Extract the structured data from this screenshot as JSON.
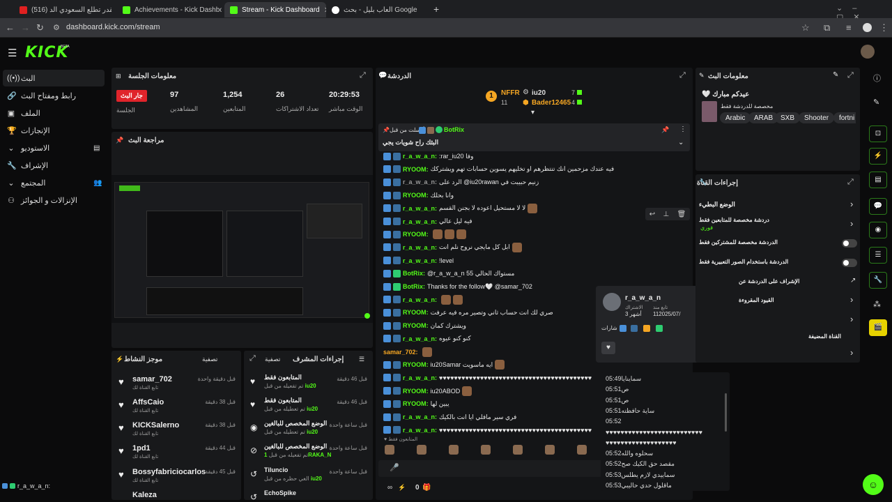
{
  "browser": {
    "tabs": [
      {
        "title": "(516) هل تقدر تطلع السعودي الد..."
      },
      {
        "title": "Achievements - Kick Dashboard"
      },
      {
        "title": "Stream - Kick Dashboard"
      },
      {
        "title": "العاب بليل - بحث Google"
      }
    ],
    "url": "dashboard.kick.com/stream",
    "new_tab": "+"
  },
  "app": {
    "logo": "KICK",
    "beta": "BETA"
  },
  "sidebar": {
    "items": [
      {
        "label": "البث",
        "icon": "live-icon"
      },
      {
        "label": "رابط ومفتاح البث",
        "icon": "link-icon"
      },
      {
        "label": "الملف",
        "icon": "profile-icon"
      },
      {
        "label": "الإنجازات",
        "icon": "trophy-icon"
      },
      {
        "label": "الاستوديو",
        "icon": "studio-icon"
      },
      {
        "label": "الإشراف",
        "icon": "wrench-icon"
      },
      {
        "label": "المجتمع",
        "icon": "community-icon"
      },
      {
        "label": "الإنزالات و الجوائز",
        "icon": "gift-icon"
      }
    ]
  },
  "session": {
    "title": "معلومات الجلسة",
    "live_badge": "جار البث",
    "stats": [
      {
        "label": "الجلسة",
        "value": ""
      },
      {
        "label": "المشاهدين",
        "value": "97"
      },
      {
        "label": "المتابعين",
        "value": "1,254"
      },
      {
        "label": "تعداد الاشتراكات",
        "value": "26"
      },
      {
        "label": "الوقت مباشر",
        "value": "20:29:53"
      }
    ]
  },
  "preview": {
    "title": "مراجعة البث"
  },
  "activity": {
    "title": "موجز النشاط",
    "filter": "تصفية",
    "items": [
      {
        "name": "samar_702",
        "sub": "تابع القناة لك",
        "time": "قبل دقيقة واحدة"
      },
      {
        "name": "AffsCaio",
        "sub": "تابع القناة لك",
        "time": "قبل 38 دقيقة"
      },
      {
        "name": "KICKSalerno",
        "sub": "تابع القناة لك",
        "time": "قبل 38 دقيقة"
      },
      {
        "name": "1pd1",
        "sub": "تابع القناة لك",
        "time": "قبل 44 دقيقة"
      },
      {
        "name": "Bossyfabriciocarlos",
        "sub": "تابع القناة لك",
        "time": "قبل 45 دقيقة"
      },
      {
        "name": "Kaleza",
        "sub": "",
        "time": ""
      }
    ]
  },
  "modlog": {
    "title": "إجراءات المشرف",
    "filter": "تصفية",
    "items": [
      {
        "name": "المتابعون فقط",
        "sub": "تم تفعيله من قبل",
        "who": "iu20",
        "time": "قبل 46 دقيقة"
      },
      {
        "name": "المتابعون فقط",
        "sub": "تم تعطيله من قبل",
        "who": "iu20",
        "time": "قبل 46 دقيقة"
      },
      {
        "name": "الوضع المخصص للبالغين",
        "sub": "تم تعطيله من قبل",
        "who": "iu20",
        "time": "قبل ساعة واحدة"
      },
      {
        "name": "الوضع المخصص للبالغين",
        "sub": "تم تفعيله من قبل",
        "who": "1RAKA_N",
        "time": "قبل ساعة واحدة"
      },
      {
        "name": "Tiluncio",
        "sub": "الغي حظره من قبل",
        "who": "iu20",
        "time": "قبل ساعة واحدة"
      },
      {
        "name": "EchoSpike",
        "sub": "",
        "who": "",
        "time": ""
      }
    ]
  },
  "chat": {
    "title": "الدردشة",
    "top": [
      {
        "rank": "1",
        "name": "NFFR",
        "count": "11"
      },
      {
        "rank": "",
        "name": "iu20",
        "count": "7"
      },
      {
        "rank": "",
        "name": "Bader12465",
        "count": "4"
      }
    ],
    "pinned": {
      "by": "أرسلت من قبل",
      "bot": "BotRix",
      "text": "البثك راح شويات يجي"
    },
    "messages": [
      {
        "user": "r_a_w_a_n",
        "text": ":rar_iu20 وفا",
        "color": "#53fc18"
      },
      {
        "user": "RYOOM",
        "text": "فيه عندك مزحمين انك تنتظرهم او تخليهم يسوين حسابات تهم ويشتركك",
        "color": "#53fc18"
      },
      {
        "user": "r_a_w_a_n",
        "text": "الرد على @iu20rawan زنيم حبيبت في",
        "color": "#999"
      },
      {
        "user": "RYOOM",
        "text": "وانا بحلك",
        "color": "#53fc18"
      },
      {
        "user": "r_a_w_a_n",
        "text": "لا لا مستحيل اعوده لا بجنن القسم",
        "color": "#53fc18"
      },
      {
        "user": "r_a_w_a_n",
        "text": "فيه ليل عالي",
        "color": "#53fc18"
      },
      {
        "user": "RYOOM",
        "text": "",
        "color": "#53fc18"
      },
      {
        "user": "r_a_w_a_n",
        "text": "ابل كل مايجي نروح نلم انت",
        "color": "#53fc18"
      },
      {
        "user": "r_a_w_a_n",
        "text": "!level",
        "color": "#53fc18"
      },
      {
        "user": "BotRix",
        "text": "@r_a_w_a_n 55 مستواك الحالي",
        "color": "#53fc18"
      },
      {
        "user": "BotRix",
        "text": "Thanks for the follow🤍 @samar_702",
        "color": "#53fc18"
      },
      {
        "user": "r_a_w_a_n",
        "text": "",
        "color": "#53fc18"
      },
      {
        "user": "RYOOM",
        "text": "صري لك انت حساب ثاني وتصير مره فيه عرفت",
        "color": "#53fc18"
      },
      {
        "user": "RYOOM",
        "text": "ويشترك كمان",
        "color": "#53fc18"
      },
      {
        "user": "r_a_w_a_n",
        "text": "كنو كنو عيوه",
        "color": "#53fc18"
      },
      {
        "user": "samar_702",
        "text": "",
        "color": "#f5a623"
      },
      {
        "user": "RYOOM",
        "text": "iu20Samar ايه ماسويت",
        "color": "#53fc18"
      },
      {
        "user": "r_a_w_a_n",
        "text": "♥♥♥♥♥♥♥♥♥♥♥♥♥♥♥♥♥♥♥♥♥♥♥♥♥♥♥♥♥♥♥♥♥♥♥♥♥♥♥♥♥",
        "color": "#53fc18"
      },
      {
        "user": "RYOOM",
        "text": "iu20ABOD",
        "color": "#53fc18"
      },
      {
        "user": "RYOOM",
        "text": "يبين لها",
        "color": "#53fc18"
      },
      {
        "user": "r_a_w_a_n",
        "text": "فري سير مافلي ايا انت بالكيك",
        "color": "#53fc18"
      },
      {
        "user": "r_a_w_a_n",
        "text": "♥♥♥♥♥♥♥♥♥♥♥♥♥♥♥♥♥♥♥♥♥♥♥♥♥♥♥♥♥♥♥♥♥♥♥♥♥♥♥♥♥",
        "color": "#53fc18"
      }
    ],
    "followers_only": "المتابعون فقط",
    "bottom_count": "0"
  },
  "user_card": {
    "name": "r_a_w_a_n",
    "follow_label": "تابع منذ",
    "follow_date": "112025/07/",
    "sub_label": "الاشتراك",
    "sub_value": "3 أشهر",
    "badges_label": "شارات",
    "history": [
      {
        "time": "05:49",
        "text": "سماينايا"
      },
      {
        "time": "05:51",
        "text": "ص"
      },
      {
        "time": "05:51",
        "text": "ص"
      },
      {
        "time": "05:51",
        "text": "ساية حافظته"
      },
      {
        "time": "05:52",
        "text": ""
      },
      {
        "time": "",
        "text": "♥♥♥♥♥♥♥♥♥♥♥♥♥♥♥♥♥♥♥♥♥♥♥♥♥♥"
      },
      {
        "time": "",
        "text": "♥♥♥♥♥♥♥♥♥♥♥♥♥♥♥♥♥♥♥"
      },
      {
        "time": "05:52",
        "text": "سحلوه والله"
      },
      {
        "time": "05:52",
        "text": "مقصد حق الكيك صح"
      },
      {
        "time": "05:53",
        "text": "سماييدي لازم يطلس"
      },
      {
        "time": "05:53",
        "text": "ماقلول حدي حاليبي"
      }
    ]
  },
  "stream_info": {
    "title": "معلومات البث",
    "heading": "🤍 عيدكم مبارك",
    "sub": "مخصصة للدردشة فقط",
    "tags": [
      "Arabic",
      "ARAB",
      "SXB",
      "Shooter",
      "fortni"
    ]
  },
  "channel": {
    "title": "إجراءات القناة",
    "rows": [
      {
        "label": "الوضع البطيء",
        "extra": ""
      },
      {
        "label": "دردشة مخصصة للمتابعين فقط",
        "extra": "فوري"
      },
      {
        "label": "الدردشة مخصصة للمشتركين فقط",
        "extra": ""
      },
      {
        "label": "الدردشة باستخدام الصور التعبيرية فقط",
        "extra": ""
      },
      {
        "label": "الإشراف على الدردشة عن",
        "extra": ""
      },
      {
        "label": "القيود المقروءة",
        "extra": ""
      },
      {
        "label": "",
        "extra": ""
      },
      {
        "label": "القناة المضيفة",
        "extra": ""
      }
    ]
  },
  "bottom_user": "r_a_w_a_n:",
  "colors": {
    "accent": "#53fc18",
    "live": "#e0242b",
    "panel": "#18191b"
  }
}
